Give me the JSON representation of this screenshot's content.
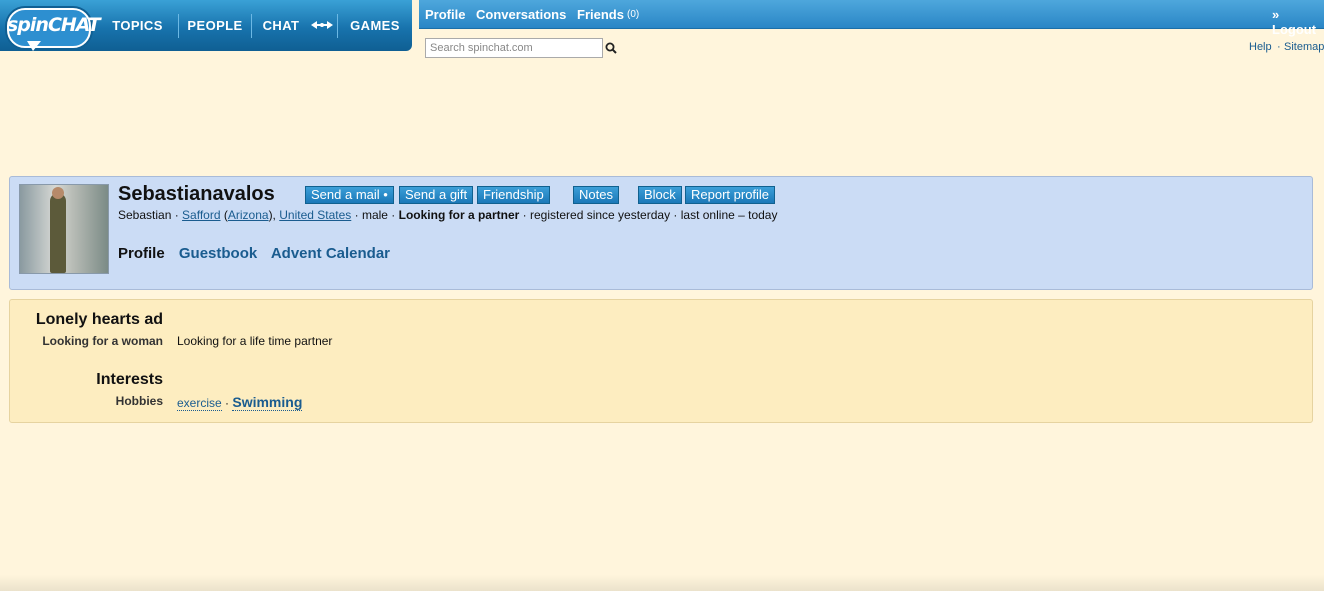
{
  "logo": {
    "text": "spinCHAT"
  },
  "nav": {
    "topics": "TOPICS",
    "people": "PEOPLE",
    "chat": "CHAT",
    "games": "GAMES"
  },
  "topbar": {
    "profile": "Profile",
    "conversations": "Conversations",
    "friends": "Friends",
    "friends_count": "(0)",
    "logout": "» Logout"
  },
  "search": {
    "placeholder": "Search spinchat.com"
  },
  "help": {
    "help": "Help",
    "sep": "·",
    "sitemap": "Sitemap"
  },
  "profile": {
    "username": "Sebastianavalos",
    "actions": {
      "send_mail": "Send a mail •",
      "send_gift": "Send a gift",
      "friendship": "Friendship",
      "notes": "Notes",
      "block": "Block",
      "report": "Report profile"
    },
    "info": {
      "first_name": "Sebastian",
      "city": "Safford",
      "state": "Arizona",
      "country": "United States",
      "gender": "male",
      "looking": "Looking for a partner",
      "registered": "registered since yesterday",
      "last_online": "last online – today"
    },
    "tabs": {
      "profile": "Profile",
      "guestbook": "Guestbook",
      "advent": "Advent Calendar"
    }
  },
  "details": {
    "lonely_heading": "Lonely hearts ad",
    "looking_label": "Looking for a woman",
    "looking_value": "Looking for a life time partner",
    "interests_heading": "Interests",
    "hobbies_label": "Hobbies",
    "hobbies": [
      "exercise",
      "Swimming"
    ]
  }
}
